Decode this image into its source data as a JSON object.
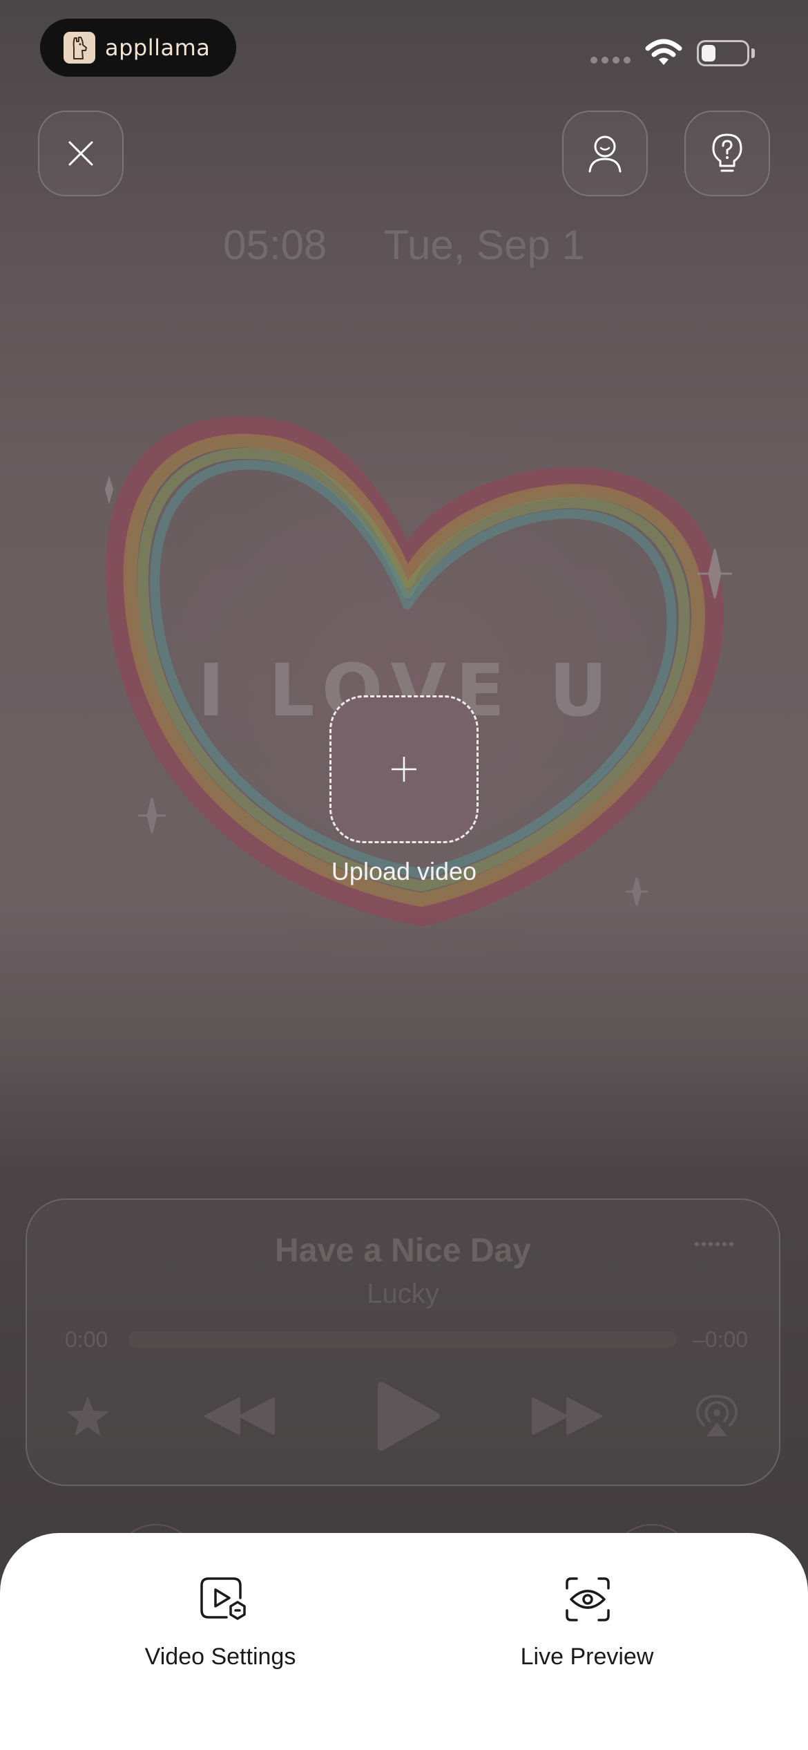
{
  "status_bar": {
    "brand_name": "appllama"
  },
  "lock_screen": {
    "time": "05:08",
    "date": "Tue, Sep 1",
    "artwork_text": "I LOVE U"
  },
  "upload": {
    "plus_symbol": "+",
    "label": "Upload video"
  },
  "music_player": {
    "title": "Have a Nice Day",
    "artist": "Lucky",
    "time_elapsed": "0:00",
    "time_remaining": "–0:00",
    "progress": 0
  },
  "bottom_sheet": {
    "items": [
      {
        "label": "Video Settings",
        "icon": "video-settings-icon"
      },
      {
        "label": "Live Preview",
        "icon": "eye-icon"
      }
    ]
  },
  "colors": {
    "background_top": "#4a4648",
    "background_mid": "#6c6063",
    "sheet": "#ffffff",
    "upload_box": "#78626a"
  }
}
